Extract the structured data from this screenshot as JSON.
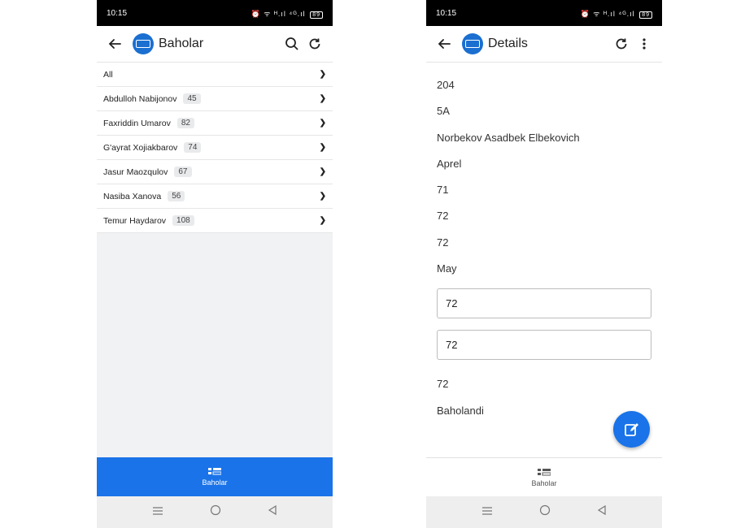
{
  "left": {
    "status": {
      "time": "10:15",
      "icons": "⏰ ᯤ ᴴ.ıl ⁴ᴳ.ıl",
      "battery": "89"
    },
    "appbar": {
      "title": "Baholar"
    },
    "list": [
      {
        "name": "All",
        "count": null
      },
      {
        "name": "Abdulloh Nabijonov",
        "count": "45"
      },
      {
        "name": "Faxriddin Umarov",
        "count": "82"
      },
      {
        "name": "G'ayrat Xojiakbarov",
        "count": "74"
      },
      {
        "name": "Jasur Maozqulov",
        "count": "67"
      },
      {
        "name": "Nasiba Xanova",
        "count": "56"
      },
      {
        "name": "Temur Haydarov",
        "count": "108"
      }
    ],
    "bottom_nav": {
      "label": "Baholar"
    }
  },
  "right": {
    "status": {
      "time": "10:15",
      "icons": "⏰ ᯤ ᴴ.ıl ⁴ᴳ.ıl",
      "battery": "89"
    },
    "appbar": {
      "title": "Details"
    },
    "details_top": [
      "204",
      "5A",
      "Norbekov Asadbek Elbekovich",
      "Aprel",
      "71",
      "72",
      "72",
      "May"
    ],
    "field_1": "72",
    "field_2": "72",
    "details_bottom": [
      "72",
      "Baholandi"
    ],
    "bottom_nav": {
      "label": "Baholar"
    }
  },
  "colors": {
    "primary": "#1a73e8"
  }
}
